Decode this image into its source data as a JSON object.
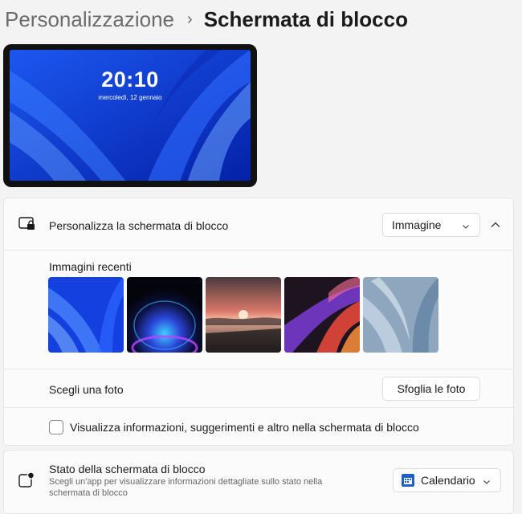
{
  "breadcrumb": {
    "parent": "Personalizzazione",
    "separator": "›",
    "title": "Schermata di blocco"
  },
  "preview": {
    "time": "20:10",
    "date": "mercoledì, 12 gennaio"
  },
  "personalize": {
    "label": "Personalizza la schermata di blocco",
    "dropdown_value": "Immagine",
    "icon": "lock-screen-icon"
  },
  "recent": {
    "label": "Immagini recenti",
    "images": [
      "windows-bloom-blue",
      "dark-glow-circle",
      "sunset-lake",
      "abstract-ribbons",
      "grey-bloom"
    ]
  },
  "choose_photo": {
    "label": "Scegli una foto",
    "button": "Sfoglia le foto"
  },
  "show_info": {
    "label": "Visualizza informazioni, suggerimenti e altro nella schermata di blocco",
    "checked": false
  },
  "status": {
    "label": "Stato della schermata di blocco",
    "description": "Scegli un'app per visualizzare informazioni dettagliate sullo stato nella schermata di blocco",
    "dropdown_value": "Calendario",
    "icon": "status-notification-icon",
    "app_icon": "calendar-icon"
  },
  "colors": {
    "accent": "#0a2fd0",
    "calendar_icon": "#1f5fc9"
  }
}
